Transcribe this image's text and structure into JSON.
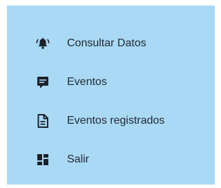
{
  "menu": {
    "background": "#a9d9f5",
    "icon_color": "#1d2127",
    "items": [
      {
        "label": "Consultar Datos",
        "icon": "bell-ring-icon"
      },
      {
        "label": "Eventos",
        "icon": "message-icon"
      },
      {
        "label": "Eventos registrados",
        "icon": "document-icon"
      },
      {
        "label": "Salir",
        "icon": "dashboard-icon"
      }
    ]
  }
}
